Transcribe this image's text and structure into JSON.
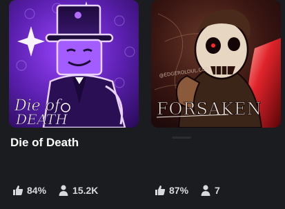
{
  "games": [
    {
      "title": "Die of Death",
      "logo_text": "Die of Death",
      "rating": "84%",
      "players": "15.2K",
      "icons": {
        "rating": "thumbs-up-icon",
        "players": "person-icon"
      },
      "colors": {
        "bg": "#4a1a8c",
        "accent": "#b46cff",
        "glow": "#e9d2ff"
      }
    },
    {
      "title": "",
      "logo_text": "FORSAKEN",
      "watermark": "@EDGEROLOUL.CON",
      "rating": "87%",
      "players": "7",
      "icons": {
        "rating": "thumbs-up-icon",
        "players": "person-icon"
      },
      "colors": {
        "bg": "#2a0d0f",
        "accent": "#d8262b",
        "skin": "#6b4a36"
      }
    }
  ]
}
